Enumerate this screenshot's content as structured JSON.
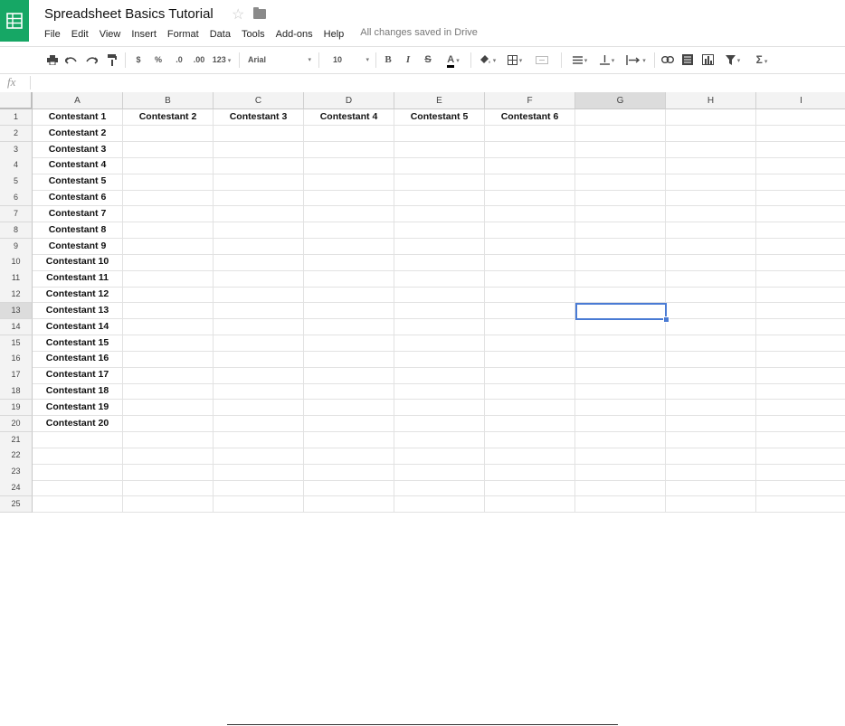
{
  "document": {
    "title": "Spreadsheet Basics Tutorial",
    "save_status": "All changes saved in Drive"
  },
  "menus": [
    "File",
    "Edit",
    "View",
    "Insert",
    "Format",
    "Data",
    "Tools",
    "Add-ons",
    "Help"
  ],
  "toolbar": {
    "currency": "$",
    "percent": "%",
    "decrease_decimals": ".0",
    "increase_decimals": ".00",
    "more_formats": "123",
    "font": "Arial",
    "font_size": "10",
    "bold": "B",
    "italic": "I",
    "strikethrough": "S",
    "text_color": "A",
    "functions": "Σ",
    "icons": [
      "print-icon",
      "undo-icon",
      "redo-icon",
      "paint-format-icon",
      "fill-color-icon",
      "borders-icon",
      "merge-cells-icon",
      "align-horizontal-icon",
      "align-vertical-icon",
      "text-wrap-icon",
      "insert-link-icon",
      "insert-comment-icon",
      "insert-chart-icon",
      "filter-icon",
      "functions-icon"
    ]
  },
  "formula_bar": {
    "fx_label": "fx",
    "value": ""
  },
  "columns": [
    "A",
    "B",
    "C",
    "D",
    "E",
    "F",
    "G",
    "H",
    "I"
  ],
  "selected_column": "G",
  "selected_row": 13,
  "active_cell": "G13",
  "rows": [
    {
      "n": "1",
      "cells": [
        "Contestant 1",
        "Contestant 2",
        "Contestant 3",
        "Contestant 4",
        "Contestant 5",
        "Contestant 6",
        "",
        "",
        ""
      ]
    },
    {
      "n": "2",
      "cells": [
        "Contestant 2",
        "",
        "",
        "",
        "",
        "",
        "",
        "",
        ""
      ]
    },
    {
      "n": "3",
      "cells": [
        "Contestant 3",
        "",
        "",
        "",
        "",
        "",
        "",
        "",
        ""
      ]
    },
    {
      "n": "4",
      "cells": [
        "Contestant 4",
        "",
        "",
        "",
        "",
        "",
        "",
        "",
        ""
      ]
    },
    {
      "n": "5",
      "cells": [
        "Contestant 5",
        "",
        "",
        "",
        "",
        "",
        "",
        "",
        ""
      ]
    },
    {
      "n": "6",
      "cells": [
        "Contestant 6",
        "",
        "",
        "",
        "",
        "",
        "",
        "",
        ""
      ]
    },
    {
      "n": "7",
      "cells": [
        "Contestant 7",
        "",
        "",
        "",
        "",
        "",
        "",
        "",
        ""
      ]
    },
    {
      "n": "8",
      "cells": [
        "Contestant 8",
        "",
        "",
        "",
        "",
        "",
        "",
        "",
        ""
      ]
    },
    {
      "n": "9",
      "cells": [
        "Contestant 9",
        "",
        "",
        "",
        "",
        "",
        "",
        "",
        ""
      ]
    },
    {
      "n": "10",
      "cells": [
        "Contestant 10",
        "",
        "",
        "",
        "",
        "",
        "",
        "",
        ""
      ]
    },
    {
      "n": "11",
      "cells": [
        "Contestant 11",
        "",
        "",
        "",
        "",
        "",
        "",
        "",
        ""
      ]
    },
    {
      "n": "12",
      "cells": [
        "Contestant 12",
        "",
        "",
        "",
        "",
        "",
        "",
        "",
        ""
      ]
    },
    {
      "n": "13",
      "cells": [
        "Contestant 13",
        "",
        "",
        "",
        "",
        "",
        "",
        "",
        ""
      ]
    },
    {
      "n": "14",
      "cells": [
        "Contestant 14",
        "",
        "",
        "",
        "",
        "",
        "",
        "",
        ""
      ]
    },
    {
      "n": "15",
      "cells": [
        "Contestant 15",
        "",
        "",
        "",
        "",
        "",
        "",
        "",
        ""
      ]
    },
    {
      "n": "16",
      "cells": [
        "Contestant 16",
        "",
        "",
        "",
        "",
        "",
        "",
        "",
        ""
      ]
    },
    {
      "n": "17",
      "cells": [
        "Contestant 17",
        "",
        "",
        "",
        "",
        "",
        "",
        "",
        ""
      ]
    },
    {
      "n": "18",
      "cells": [
        "Contestant 18",
        "",
        "",
        "",
        "",
        "",
        "",
        "",
        ""
      ]
    },
    {
      "n": "19",
      "cells": [
        "Contestant 19",
        "",
        "",
        "",
        "",
        "",
        "",
        "",
        ""
      ]
    },
    {
      "n": "20",
      "cells": [
        "Contestant 20",
        "",
        "",
        "",
        "",
        "",
        "",
        "",
        ""
      ]
    },
    {
      "n": "21",
      "cells": [
        "",
        "",
        "",
        "",
        "",
        "",
        "",
        "",
        ""
      ]
    },
    {
      "n": "22",
      "cells": [
        "",
        "",
        "",
        "",
        "",
        "",
        "",
        "",
        ""
      ]
    },
    {
      "n": "23",
      "cells": [
        "",
        "",
        "",
        "",
        "",
        "",
        "",
        "",
        ""
      ]
    },
    {
      "n": "24",
      "cells": [
        "",
        "",
        "",
        "",
        "",
        "",
        "",
        "",
        ""
      ]
    },
    {
      "n": "25",
      "cells": [
        "",
        "",
        "",
        "",
        "",
        "",
        "",
        "",
        ""
      ]
    }
  ],
  "colors": {
    "brand": "#16a765",
    "selection": "#4a7bd4",
    "header_bg": "#f3f3f3",
    "selected_header_bg": "#dcdcdc"
  }
}
